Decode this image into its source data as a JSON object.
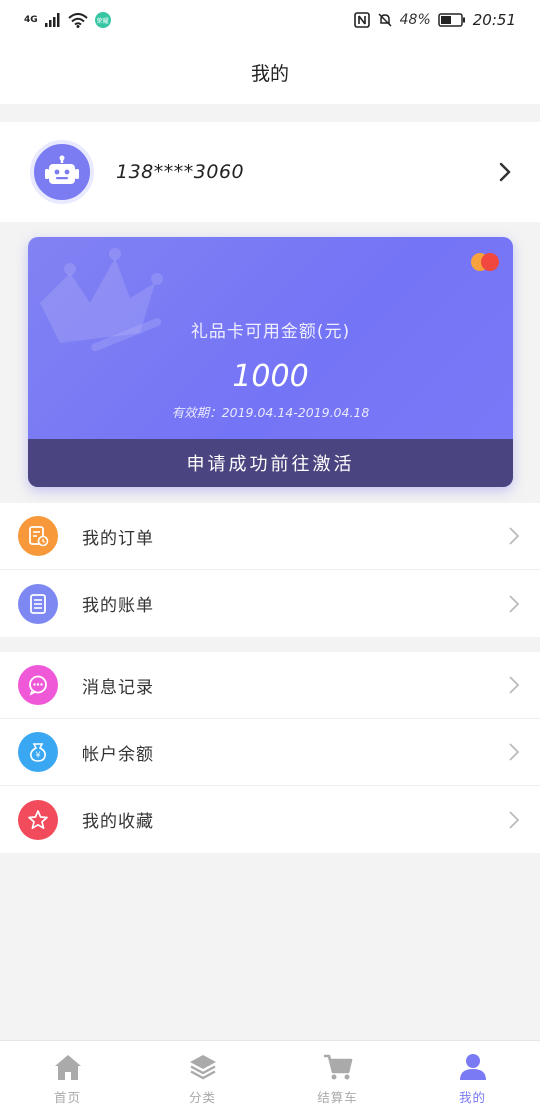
{
  "status_bar": {
    "network": "4G",
    "battery_pct": "48%",
    "time": "20:51",
    "wifi_badge": "荣耀"
  },
  "header": {
    "title": "我的"
  },
  "profile": {
    "phone": "138****3060"
  },
  "gift_card": {
    "title": "礼品卡可用金额(元)",
    "amount": "1000",
    "validity": "有效期：2019.04.14-2019.04.18",
    "action": "申请成功前往激活",
    "colors": {
      "card": "#7a7af5",
      "footer": "#4a4580"
    }
  },
  "menu_group_1": [
    {
      "label": "我的订单",
      "icon": "order-icon",
      "color": "#f7993a"
    },
    {
      "label": "我的账单",
      "icon": "bill-icon",
      "color": "#7e88f2"
    }
  ],
  "menu_group_2": [
    {
      "label": "消息记录",
      "icon": "message-icon",
      "color": "#ef59d8"
    },
    {
      "label": "帐户余额",
      "icon": "wallet-icon",
      "color": "#3aa7f3"
    },
    {
      "label": "我的收藏",
      "icon": "star-icon",
      "color": "#f24b5b"
    }
  ],
  "tabbar": {
    "tabs": [
      {
        "label": "首页",
        "icon": "home-icon",
        "active": false
      },
      {
        "label": "分类",
        "icon": "layers-icon",
        "active": false
      },
      {
        "label": "结算车",
        "icon": "cart-icon",
        "active": false
      },
      {
        "label": "我的",
        "icon": "user-icon",
        "active": true
      }
    ],
    "active_color": "#7a7af5"
  }
}
